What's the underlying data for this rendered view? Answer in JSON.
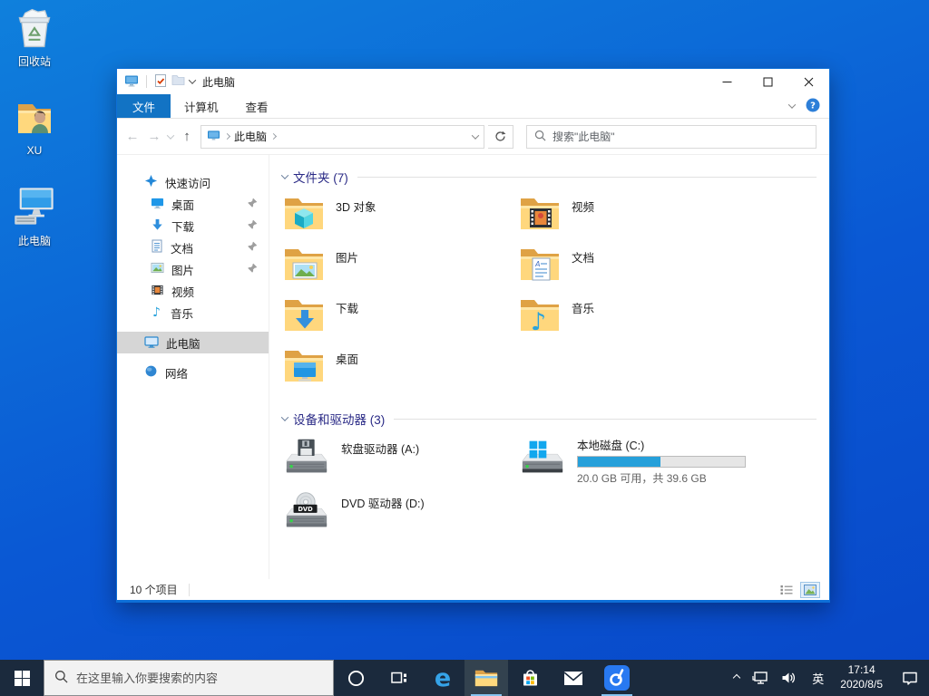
{
  "desktop": {
    "icons": [
      {
        "label": "回收站"
      },
      {
        "label": "XU"
      },
      {
        "label": "此电脑"
      }
    ]
  },
  "explorer": {
    "title": "此电脑",
    "tabs": {
      "file": "文件",
      "computer": "计算机",
      "view": "查看"
    },
    "nav": {
      "breadcrumb_root": "此电脑",
      "search_placeholder": "搜索\"此电脑\""
    },
    "sidebar": {
      "items": [
        {
          "label": "快速访问"
        },
        {
          "label": "桌面"
        },
        {
          "label": "下载"
        },
        {
          "label": "文档"
        },
        {
          "label": "图片"
        },
        {
          "label": "视频"
        },
        {
          "label": "音乐"
        },
        {
          "label": "此电脑"
        },
        {
          "label": "网络"
        }
      ]
    },
    "groups": {
      "folders": {
        "title": "文件夹 (7)",
        "items": [
          "3D 对象",
          "视频",
          "图片",
          "文档",
          "下载",
          "音乐",
          "桌面"
        ]
      },
      "devices": {
        "title": "设备和驱动器 (3)",
        "floppy_label": "软盘驱动器 (A:)",
        "disk_c_label": "本地磁盘 (C:)",
        "disk_c_usage": "20.0 GB 可用，共 39.6 GB",
        "disk_c_percent_used": 49.5,
        "dvd_label": "DVD 驱动器 (D:)"
      }
    },
    "status": "10 个项目"
  },
  "taskbar": {
    "search_placeholder": "在这里输入你要搜索的内容",
    "ime_label": "英",
    "clock": {
      "time": "17:14",
      "date": "2020/8/5"
    }
  },
  "colors": {
    "accent": "#0d6fd8",
    "desktop": "#0a58d4",
    "taskbar": "#1b2a3d",
    "disk_fill": "#26a0da",
    "file_tab": "#1273c4"
  }
}
